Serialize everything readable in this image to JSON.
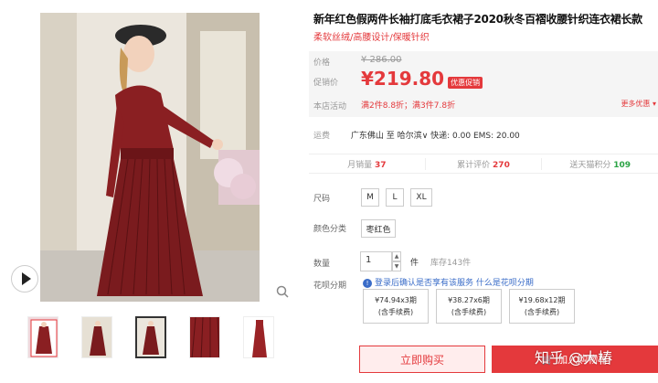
{
  "product": {
    "title": "新年红色假两件长袖打底毛衣裙子2020秋冬百褶收腰针织连衣裙长款",
    "subtitle": "柔软丝绒/高腰设计/保暖针织"
  },
  "price": {
    "label": "价格",
    "original": "¥ 286.00",
    "promo_label": "促销价",
    "promo": "¥219.80",
    "promo_tag": "优惠促销",
    "activity_label": "本店活动",
    "activity": "满2件8.8折；满3件7.8折",
    "more": "更多优惠"
  },
  "shipping": {
    "label": "运费",
    "from": "广东佛山",
    "to_word": "至",
    "to": "哈尔滨",
    "fee": "快递: 0.00 EMS: 20.00"
  },
  "stats": {
    "monthly_label": "月销量",
    "monthly": "37",
    "reviews_label": "累计评价",
    "reviews": "270",
    "points_label": "送天猫积分",
    "points": "109"
  },
  "size": {
    "label": "尺码",
    "options": [
      "M",
      "L",
      "XL"
    ]
  },
  "color": {
    "label": "颜色分类",
    "options": [
      "枣红色"
    ]
  },
  "quantity": {
    "label": "数量",
    "value": "1",
    "unit": "件",
    "stock": "库存143件"
  },
  "huabei": {
    "label": "花呗分期",
    "note": "登录后确认是否享有该服务",
    "link": "什么是花呗分期",
    "plans": [
      {
        "amount": "¥74.94x3期",
        "fee": "(含手续费)"
      },
      {
        "amount": "¥38.27x6期",
        "fee": "(含手续费)"
      },
      {
        "amount": "¥19.68x12期",
        "fee": "(含手续费)"
      }
    ]
  },
  "actions": {
    "buy": "立即购买",
    "cart": "加入购物车"
  },
  "watermark": "知乎 @大椿",
  "colors": {
    "accent": "#e4393c",
    "link": "#3a6cc8",
    "points": "#2aa344"
  }
}
